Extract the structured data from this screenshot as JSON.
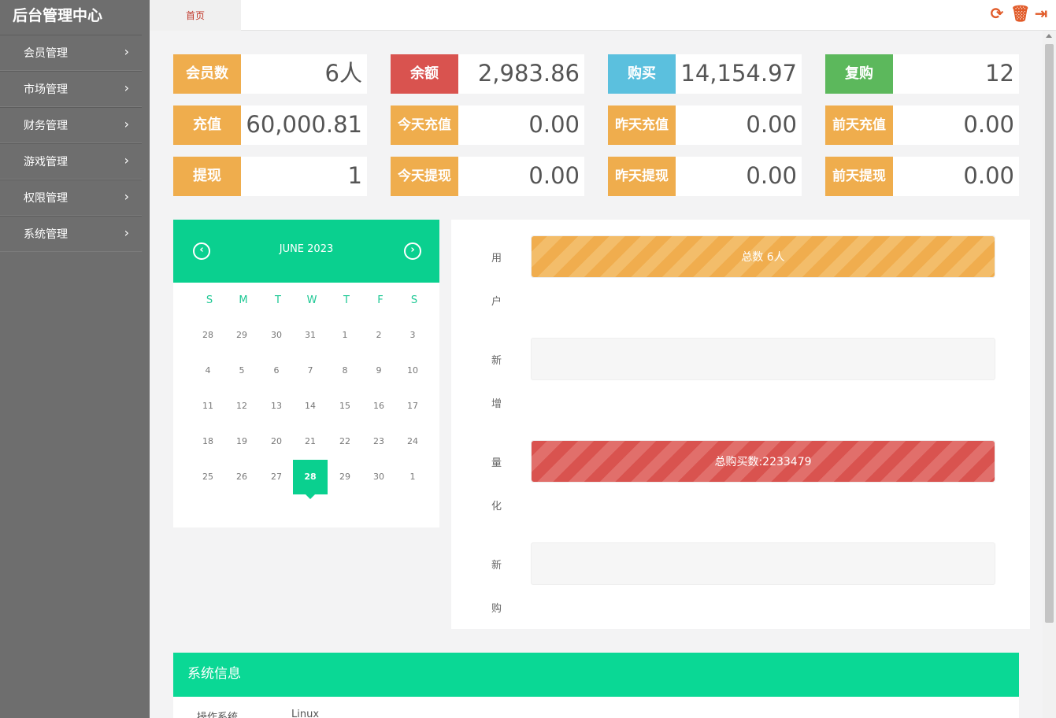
{
  "app": {
    "title": "后台管理中心"
  },
  "sidebar": {
    "items": [
      {
        "label": "会员管理"
      },
      {
        "label": "市场管理"
      },
      {
        "label": "财务管理"
      },
      {
        "label": "游戏管理"
      },
      {
        "label": "权限管理"
      },
      {
        "label": "系统管理"
      }
    ],
    "chevron": "›"
  },
  "topbar": {
    "tab_home": "首页",
    "icons": [
      "refresh-icon",
      "trash-icon",
      "logout-icon"
    ],
    "icon_color": "#e15a28"
  },
  "stats": [
    {
      "label": "会员数",
      "value": "6人",
      "color": "#efad4d"
    },
    {
      "label": "余额",
      "value": "2,983.86",
      "color": "#d9534f"
    },
    {
      "label": "购买",
      "value": "14,154.97",
      "color": "#5bc0de"
    },
    {
      "label": "复购",
      "value": "12",
      "color": "#5cb85c"
    },
    {
      "label": "充值",
      "value": "60,000.81",
      "color": "#efad4d"
    },
    {
      "label": "今天充值",
      "value": "0.00",
      "color": "#efad4d"
    },
    {
      "label": "昨天充值",
      "value": "0.00",
      "color": "#efad4d"
    },
    {
      "label": "前天充值",
      "value": "0.00",
      "color": "#efad4d"
    },
    {
      "label": "提现",
      "value": "1",
      "color": "#efad4d"
    },
    {
      "label": "今天提现",
      "value": "0.00",
      "color": "#efad4d"
    },
    {
      "label": "昨天提现",
      "value": "0.00",
      "color": "#efad4d"
    },
    {
      "label": "前天提现",
      "value": "0.00",
      "color": "#efad4d"
    }
  ],
  "calendar": {
    "title": "JUNE 2023",
    "prev": "‹",
    "next": "›",
    "weekdays": [
      "S",
      "M",
      "T",
      "W",
      "T",
      "F",
      "S"
    ],
    "weeks": [
      [
        "28",
        "29",
        "30",
        "31",
        "1",
        "2",
        "3"
      ],
      [
        "4",
        "5",
        "6",
        "7",
        "8",
        "9",
        "10"
      ],
      [
        "11",
        "12",
        "13",
        "14",
        "15",
        "16",
        "17"
      ],
      [
        "18",
        "19",
        "20",
        "21",
        "22",
        "23",
        "24"
      ],
      [
        "25",
        "26",
        "27",
        "28",
        "29",
        "30",
        "1"
      ]
    ],
    "today": "28",
    "accent": "#0ad08f"
  },
  "chart": {
    "vertical_labels": [
      "用",
      "户",
      "新",
      "增",
      "量",
      "化",
      "新",
      "购"
    ],
    "bars": [
      {
        "text": "总数 6人",
        "fill": 1.0,
        "style": "orange"
      },
      {
        "text": "",
        "fill": 0,
        "style": "orange"
      },
      {
        "text": "总购买数:2233479",
        "fill": 1.0,
        "style": "red"
      },
      {
        "text": "",
        "fill": 0,
        "style": "red"
      }
    ]
  },
  "sysinfo": {
    "title": "系统信息",
    "rows": [
      {
        "key": "操作系统",
        "value": "Linux"
      }
    ]
  }
}
